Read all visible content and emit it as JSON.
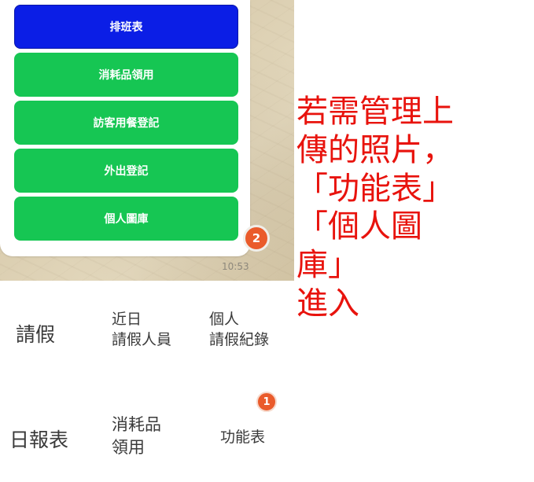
{
  "chat": {
    "menu_buttons": [
      {
        "label": "排班表",
        "color": "#0b1ee6"
      },
      {
        "label": "消耗品領用",
        "color": "#16c653"
      },
      {
        "label": "訪客用餐登記",
        "color": "#16c653"
      },
      {
        "label": "外出登記",
        "color": "#16c653"
      },
      {
        "label": "個人圖庫",
        "color": "#16c653"
      }
    ],
    "badge_count": "2",
    "timestamp": "10:53"
  },
  "annotation": {
    "lines": [
      "若需管理上",
      "傳的照片，",
      "「功能表」",
      "「個人圖",
      "庫」",
      "進入"
    ],
    "color": "#e8130d"
  },
  "rich_menu": {
    "row1": {
      "leave": "請假",
      "recent_line1": "近日",
      "recent_line2": "請假人員",
      "personal_line1": "個人",
      "personal_line2": "請假紀錄"
    },
    "row2": {
      "daily_report": "日報表",
      "consumables_line1": "消耗品",
      "consumables_line2": "領用",
      "function_menu": "功能表",
      "badge_count": "1"
    }
  }
}
